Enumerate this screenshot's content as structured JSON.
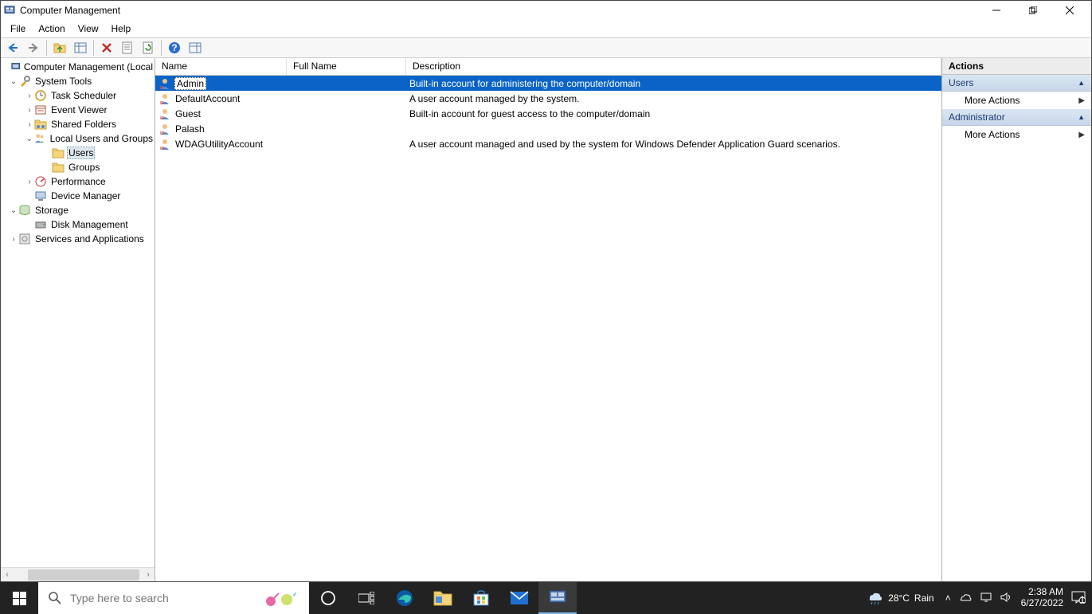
{
  "window": {
    "title": "Computer Management"
  },
  "menus": {
    "file": "File",
    "action": "Action",
    "view": "View",
    "help": "Help"
  },
  "tree": {
    "root": "Computer Management (Local",
    "system_tools": "System Tools",
    "task_scheduler": "Task Scheduler",
    "event_viewer": "Event Viewer",
    "shared_folders": "Shared Folders",
    "local_users": "Local Users and Groups",
    "users": "Users",
    "groups": "Groups",
    "performance": "Performance",
    "device_manager": "Device Manager",
    "storage": "Storage",
    "disk_management": "Disk Management",
    "services_apps": "Services and Applications"
  },
  "list": {
    "headers": {
      "name": "Name",
      "full": "Full Name",
      "desc": "Description"
    },
    "rows": [
      {
        "name": "Admin",
        "full": "",
        "desc": "Built-in account for administering the computer/domain",
        "selected": true
      },
      {
        "name": "DefaultAccount",
        "full": "",
        "desc": "A user account managed by the system.",
        "selected": false
      },
      {
        "name": "Guest",
        "full": "",
        "desc": "Built-in account for guest access to the computer/domain",
        "selected": false
      },
      {
        "name": "Palash",
        "full": "",
        "desc": "",
        "selected": false
      },
      {
        "name": "WDAGUtilityAccount",
        "full": "",
        "desc": "A user account managed and used by the system for Windows Defender Application Guard scenarios.",
        "selected": false
      }
    ]
  },
  "actions": {
    "title": "Actions",
    "group1": "Users",
    "group2": "Administrator",
    "more": "More Actions"
  },
  "taskbar": {
    "search_placeholder": "Type here to search",
    "weather_temp": "28°C",
    "weather_cond": "Rain",
    "time": "2:38 AM",
    "date": "6/27/2022"
  }
}
